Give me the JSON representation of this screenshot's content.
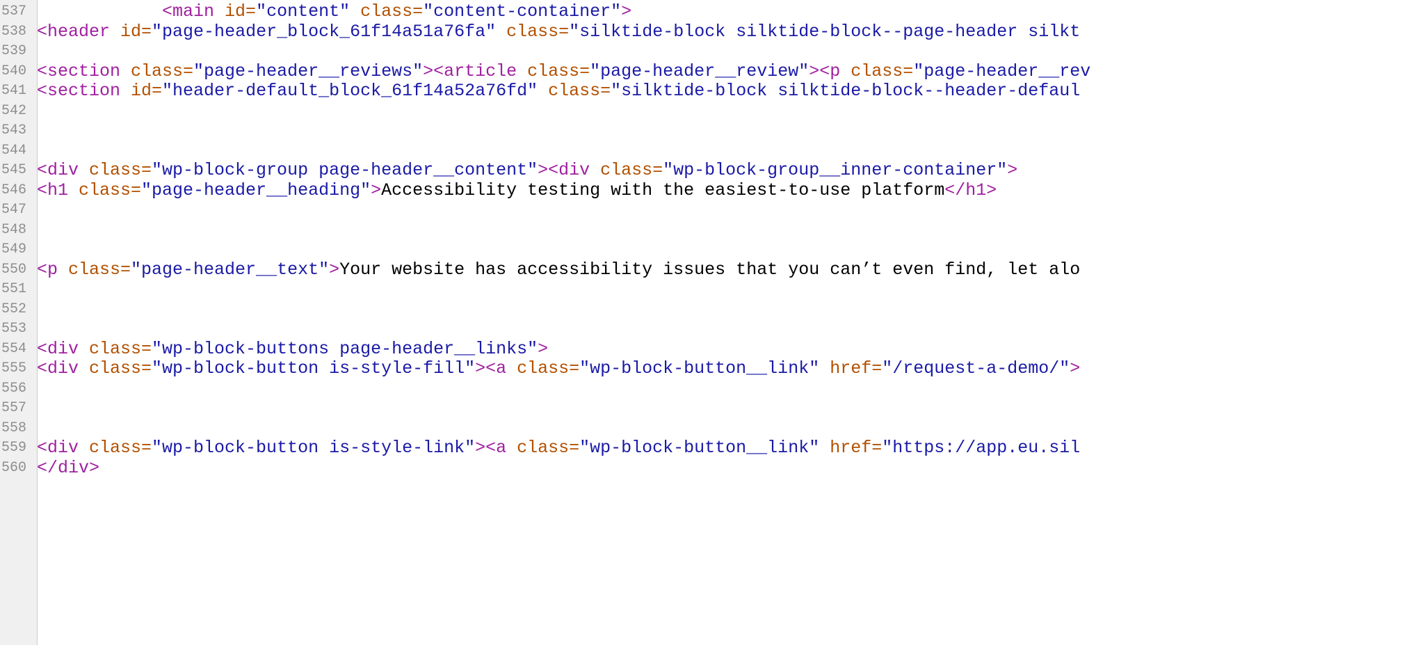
{
  "view": {
    "kind": "view-source",
    "wrap_long_lines": false,
    "gutter_background": "#f0f0f0",
    "gutter_border_color": "#cccccc",
    "page_background": "#ffffff"
  },
  "syntax_colors": {
    "tag": "#a020a0",
    "attribute_name": "#b35000",
    "attribute_value": "#1a1aa6",
    "text": "#000000",
    "line_number": "#8e8e8e"
  },
  "lines": [
    {
      "number": "537",
      "tokens": [
        {
          "t": "txt",
          "s": "            "
        },
        {
          "t": "tag",
          "s": "<main "
        },
        {
          "t": "attr",
          "s": "id="
        },
        {
          "t": "val",
          "s": "\"content\""
        },
        {
          "t": "txt",
          "s": " "
        },
        {
          "t": "attr",
          "s": "class="
        },
        {
          "t": "val",
          "s": "\"content-container\""
        },
        {
          "t": "tag",
          "s": ">"
        }
      ]
    },
    {
      "number": "538",
      "tokens": [
        {
          "t": "tag",
          "s": "<header "
        },
        {
          "t": "attr",
          "s": "id="
        },
        {
          "t": "val",
          "s": "\"page-header_block_61f14a51a76fa\""
        },
        {
          "t": "txt",
          "s": " "
        },
        {
          "t": "attr",
          "s": "class="
        },
        {
          "t": "val",
          "s": "\"silktide-block silktide-block--page-header silkt"
        }
      ]
    },
    {
      "number": "539",
      "tokens": []
    },
    {
      "number": "540",
      "tokens": [
        {
          "t": "tag",
          "s": "<section "
        },
        {
          "t": "attr",
          "s": "class="
        },
        {
          "t": "val",
          "s": "\"page-header__reviews\""
        },
        {
          "t": "tag",
          "s": "><article "
        },
        {
          "t": "attr",
          "s": "class="
        },
        {
          "t": "val",
          "s": "\"page-header__review\""
        },
        {
          "t": "tag",
          "s": "><p "
        },
        {
          "t": "attr",
          "s": "class="
        },
        {
          "t": "val",
          "s": "\"page-header__rev"
        }
      ]
    },
    {
      "number": "541",
      "tokens": [
        {
          "t": "tag",
          "s": "<section "
        },
        {
          "t": "attr",
          "s": "id="
        },
        {
          "t": "val",
          "s": "\"header-default_block_61f14a52a76fd\""
        },
        {
          "t": "txt",
          "s": " "
        },
        {
          "t": "attr",
          "s": "class="
        },
        {
          "t": "val",
          "s": "\"silktide-block silktide-block--header-defaul"
        }
      ]
    },
    {
      "number": "542",
      "tokens": []
    },
    {
      "number": "543",
      "tokens": []
    },
    {
      "number": "544",
      "tokens": []
    },
    {
      "number": "545",
      "tokens": [
        {
          "t": "tag",
          "s": "<div "
        },
        {
          "t": "attr",
          "s": "class="
        },
        {
          "t": "val",
          "s": "\"wp-block-group page-header__content\""
        },
        {
          "t": "tag",
          "s": "><div "
        },
        {
          "t": "attr",
          "s": "class="
        },
        {
          "t": "val",
          "s": "\"wp-block-group__inner-container\""
        },
        {
          "t": "tag",
          "s": ">"
        }
      ]
    },
    {
      "number": "546",
      "tokens": [
        {
          "t": "tag",
          "s": "<h1 "
        },
        {
          "t": "attr",
          "s": "class="
        },
        {
          "t": "val",
          "s": "\"page-header__heading\""
        },
        {
          "t": "tag",
          "s": ">"
        },
        {
          "t": "txt",
          "s": "Accessibility testing with the easiest-to-use platform"
        },
        {
          "t": "tag",
          "s": "</h1>"
        }
      ]
    },
    {
      "number": "547",
      "tokens": []
    },
    {
      "number": "548",
      "tokens": []
    },
    {
      "number": "549",
      "tokens": []
    },
    {
      "number": "550",
      "tokens": [
        {
          "t": "tag",
          "s": "<p "
        },
        {
          "t": "attr",
          "s": "class="
        },
        {
          "t": "val",
          "s": "\"page-header__text\""
        },
        {
          "t": "tag",
          "s": ">"
        },
        {
          "t": "txt",
          "s": "Your website has accessibility issues that you can’t even find, let alo"
        }
      ]
    },
    {
      "number": "551",
      "tokens": []
    },
    {
      "number": "552",
      "tokens": []
    },
    {
      "number": "553",
      "tokens": []
    },
    {
      "number": "554",
      "tokens": [
        {
          "t": "tag",
          "s": "<div "
        },
        {
          "t": "attr",
          "s": "class="
        },
        {
          "t": "val",
          "s": "\"wp-block-buttons page-header__links\""
        },
        {
          "t": "tag",
          "s": ">"
        }
      ]
    },
    {
      "number": "555",
      "tokens": [
        {
          "t": "tag",
          "s": "<div "
        },
        {
          "t": "attr",
          "s": "class="
        },
        {
          "t": "val",
          "s": "\"wp-block-button is-style-fill\""
        },
        {
          "t": "tag",
          "s": "><a "
        },
        {
          "t": "attr",
          "s": "class="
        },
        {
          "t": "val",
          "s": "\"wp-block-button__link\""
        },
        {
          "t": "txt",
          "s": " "
        },
        {
          "t": "attr",
          "s": "href="
        },
        {
          "t": "val",
          "s": "\"/request-a-demo/\""
        },
        {
          "t": "tag",
          "s": ">"
        }
      ]
    },
    {
      "number": "556",
      "tokens": []
    },
    {
      "number": "557",
      "tokens": []
    },
    {
      "number": "558",
      "tokens": []
    },
    {
      "number": "559",
      "tokens": [
        {
          "t": "tag",
          "s": "<div "
        },
        {
          "t": "attr",
          "s": "class="
        },
        {
          "t": "val",
          "s": "\"wp-block-button is-style-link\""
        },
        {
          "t": "tag",
          "s": "><a "
        },
        {
          "t": "attr",
          "s": "class="
        },
        {
          "t": "val",
          "s": "\"wp-block-button__link\""
        },
        {
          "t": "txt",
          "s": " "
        },
        {
          "t": "attr",
          "s": "href="
        },
        {
          "t": "val",
          "s": "\"https://app.eu.sil"
        }
      ]
    },
    {
      "number": "560",
      "tokens": [
        {
          "t": "tag",
          "s": "</div>"
        }
      ]
    }
  ]
}
